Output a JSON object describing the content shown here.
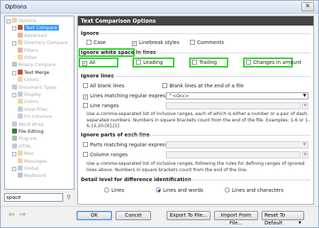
{
  "window": {
    "title": "Options",
    "close_glyph": "✕"
  },
  "tree": [
    {
      "label": "Options",
      "dim": true,
      "exp": "-",
      "icon": "options-icon",
      "color": "#d9a13b"
    },
    {
      "label": "Text Compare",
      "dim": false,
      "selected": true,
      "exp": "-",
      "icon": "text-compare-icon",
      "color": "#c94c3a"
    },
    {
      "label": "Advanced",
      "dim": true,
      "icon": "advanced-icon",
      "color": "#c94c3a"
    },
    {
      "label": "Directory Compare",
      "dim": true,
      "exp": "-",
      "icon": "directory-compare-icon",
      "color": "#d9a13b"
    },
    {
      "label": "Filters",
      "dim": true,
      "icon": "filters-icon",
      "color": "#c94c3a"
    },
    {
      "label": "Other",
      "dim": true,
      "icon": "other-icon",
      "color": "#d9a13b"
    },
    {
      "label": "Binary Compare",
      "dim": true,
      "icon": "binary-compare-icon",
      "color": "#7a7a7a"
    },
    {
      "label": "Text Merge",
      "dim": false,
      "exp": "-",
      "icon": "text-merge-icon",
      "color": "#c94c3a"
    },
    {
      "label": "Colors",
      "dim": true,
      "icon": "colors-icon",
      "color": "#d9a13b"
    },
    {
      "label": "Document Types",
      "dim": true,
      "icon": "document-types-icon",
      "color": "#6d8fb5"
    },
    {
      "label": "Display",
      "dim": true,
      "exp": "-",
      "icon": "display-icon",
      "color": "#6d8fb5"
    },
    {
      "label": "Colors",
      "dim": true,
      "icon": "colors-icon",
      "color": "#d9a13b"
    },
    {
      "label": "View Filter",
      "dim": true,
      "icon": "view-filter-icon",
      "color": "#6d8fb5"
    },
    {
      "label": "Fin Columns",
      "dim": true,
      "icon": "fin-columns-icon",
      "color": "#6d8fb5"
    },
    {
      "label": "Word Wrap",
      "dim": true,
      "icon": "word-wrap-icon",
      "color": "#6d8fb5"
    },
    {
      "label": "File Editing",
      "dim": false,
      "icon": "file-editing-icon",
      "color": "#3a7d3a"
    },
    {
      "label": "Plug-ins",
      "dim": true,
      "icon": "plugins-icon",
      "color": "#3a7d3a"
    },
    {
      "label": "HTML",
      "dim": true,
      "icon": "html-icon",
      "color": "#6d8fb5"
    },
    {
      "label": "Misc",
      "dim": true,
      "exp": "-",
      "icon": "misc-icon",
      "color": "#d9a13b"
    },
    {
      "label": "Messages",
      "dim": true,
      "icon": "messages-icon",
      "color": "#d9a13b"
    },
    {
      "label": "Global",
      "dim": true,
      "exp": "-",
      "icon": "global-icon",
      "color": "#6d8fb5"
    },
    {
      "label": "Keyboard",
      "dim": true,
      "icon": "keyboard-icon",
      "color": "#7a7a7a"
    }
  ],
  "search": {
    "value": "space"
  },
  "panel": {
    "header": "Text Comparison Options",
    "ignore": {
      "title": "Ignore",
      "case": "Case",
      "linebreak": "Linebreak styles",
      "comments": "Comments"
    },
    "whitespace": {
      "title": "Ignore white space in lines",
      "all": "All",
      "leading": "Leading",
      "trailing": "Trailing",
      "changes": "Changes in amount"
    },
    "lines": {
      "title": "Ignore lines",
      "all_blank": "All blank lines",
      "blank_end": "Blank lines at the end of a file",
      "regex": "Lines matching regular expression",
      "regex_value": "^<Occ>",
      "ranges": "Line ranges",
      "help": "Use a comma-separated list of inclusive ranges, each of which is either a number or a pair of dash-separated numbers. Numbers in square brackets count from the end of the file. Examples: 1-6 or 1-6,12,20-[6],[1]"
    },
    "parts": {
      "title": "Ignore parts of each line",
      "parts_regex": "Parts matching regular expression",
      "column_ranges": "Column ranges",
      "help": "Use a comma-separated list of inclusive ranges, following the rules for defining ranges of ignored lines above. Numbers in square brackets count from the end of the line."
    },
    "detail": {
      "title": "Detail level for difference identification",
      "lines": "Lines",
      "lines_words": "Lines and words",
      "lines_chars": "Lines and characters",
      "selected": "Lines and words"
    }
  },
  "footer": {
    "ok": "OK",
    "cancel": "Cancel",
    "export": "Export To File...",
    "import": "Import From File...",
    "reset": "Reset To Default",
    "reset_arrow": "▼",
    "back": "⇦",
    "forward": "⇨"
  },
  "colors": {
    "highlight_green": "#27d31f",
    "header_bg": "#444444",
    "selection": "#3399ff"
  }
}
